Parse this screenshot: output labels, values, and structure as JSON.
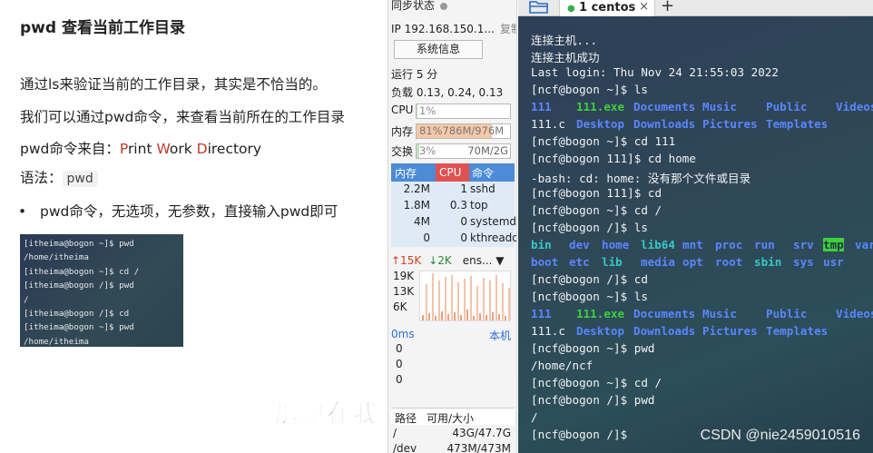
{
  "document": {
    "heading": "pwd 查看当前工作目录",
    "para1": "通过ls来验证当前的工作目录，其实是不恰当的。",
    "para2": "我们可以通过pwd命令，来查看当前所在的工作目录",
    "origin_prefix": "pwd命令来自：",
    "origin_P": "P",
    "origin_rint": "rint ",
    "origin_W": "W",
    "origin_ork": "ork ",
    "origin_D": "D",
    "origin_irectory": "irectory",
    "syntax_label": "语法：",
    "syntax_code": "pwd",
    "bullet": "pwd命令，无选项，无参数，直接输入pwd即可",
    "mini_terminal": [
      "[itheima@bogon ~]$ pwd",
      "/home/itheima",
      "[itheima@bogon ~]$ cd /",
      "[itheima@bogon /]$ pwd",
      "/",
      "[itheima@bogon /]$ cd",
      "[itheima@bogon ~]$ pwd",
      "/home/itheima"
    ],
    "subtitle": "那现在我"
  },
  "panel": {
    "sync_label": "同步状态",
    "ip": "IP 192.168.150.1...",
    "copy": "复制",
    "sysinfo_button": "系统信息",
    "uptime": "运行 5 分",
    "load": "负载 0.13, 0.24, 0.13",
    "cpu_label": "CPU",
    "cpu_text": "1%",
    "cpu_fraction": 0.01,
    "mem_label": "内存",
    "mem_text": "81%786M/976M",
    "mem_fraction": 0.81,
    "swap_label": "交换",
    "swap_text": "3%",
    "swap_right": "70M/2G",
    "swap_fraction": 0.03,
    "proc_headers": [
      "内存",
      "CPU",
      "命令"
    ],
    "processes": [
      {
        "mem": "2.2M",
        "cpu": "1",
        "cmd": "sshd"
      },
      {
        "mem": "1.8M",
        "cpu": "0.3",
        "cmd": "top"
      },
      {
        "mem": "4M",
        "cpu": "0",
        "cmd": "systemd"
      },
      {
        "mem": "0",
        "cpu": "0",
        "cmd": "kthreadd"
      }
    ],
    "net_up": "↑15K",
    "net_down": "↓2K",
    "net_iface": "ens...",
    "net_axis": [
      "19K",
      "13K",
      "6K"
    ],
    "latency": "0ms",
    "latency_local": "本机",
    "latency_axis": [
      "0",
      "0",
      "0"
    ],
    "disk_headers": [
      "路径",
      "可用/大小"
    ],
    "disks": [
      {
        "path": "/",
        "size": "43G/47.7G"
      },
      {
        "path": "/dev",
        "size": "473M/473M"
      }
    ]
  },
  "terminal": {
    "tab_name": "1 centos",
    "tab_close": "×",
    "tab_add": "+",
    "watermark": "CSDN @nie2459010516",
    "lines": {
      "l1": "连接主机...",
      "l2": "连接主机成功",
      "l3": "Last login: Thu Nov 24 21:55:03 2022",
      "l4": "[ncf@bogon ~]$ ls",
      "l7": "[ncf@bogon ~]$ cd 111",
      "l8": "[ncf@bogon 111]$ cd home",
      "l9": "-bash: cd: home: 没有那个文件或目录",
      "l10": "[ncf@bogon 111]$ cd",
      "l11": "[ncf@bogon ~]$ cd /",
      "l12": "[ncf@bogon /]$ ls",
      "l15": "[ncf@bogon /]$ cd",
      "l16": "[ncf@bogon ~]$ ls",
      "l19": "[ncf@bogon ~]$ pwd",
      "l20": "/home/ncf",
      "l21": "[ncf@bogon ~]$ cd /",
      "l22": "[ncf@bogon /]$ pwd",
      "l23": "/",
      "l24": "[ncf@bogon /]$"
    },
    "home_ls": {
      "row1": [
        "111",
        "111.exe",
        "Documents",
        "Music",
        "Public",
        "Videos"
      ],
      "row2": [
        "111.c",
        "Desktop",
        "Downloads",
        "Pictures",
        "Templates"
      ]
    },
    "root_ls": {
      "row1": [
        "bin",
        "dev",
        "home",
        "lib64",
        "mnt",
        "proc",
        "run",
        "srv",
        "tmp",
        "var"
      ],
      "row2": [
        "boot",
        "etc",
        "lib",
        "media",
        "opt",
        "root",
        "sbin",
        "sys",
        "usr"
      ]
    }
  }
}
